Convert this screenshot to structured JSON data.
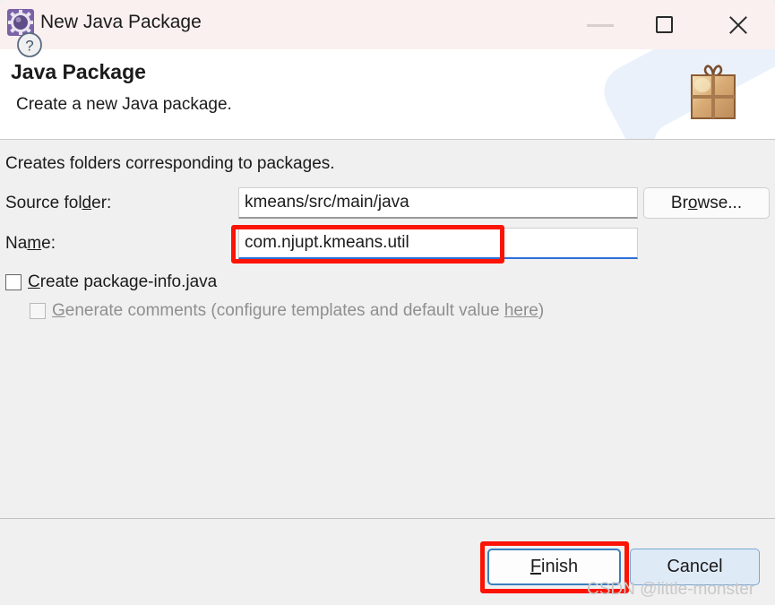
{
  "window": {
    "title": "New Java Package",
    "app_icon": "java-package-gear-icon",
    "controls": {
      "minimize": "Minimize",
      "maximize": "Maximize",
      "close": "Close"
    }
  },
  "header": {
    "title": "Java Package",
    "subtitle": "Create a new Java package.",
    "icon": "gift-box-icon"
  },
  "main": {
    "hint": "Creates folders corresponding to packages.",
    "source_folder": {
      "label_before": "Source fol",
      "label_mnemonic": "d",
      "label_after": "er:",
      "value": "kmeans/src/main/java",
      "placeholder": ""
    },
    "name": {
      "label_before": "Na",
      "label_mnemonic": "m",
      "label_after": "e:",
      "value": "com.njupt.kmeans.util",
      "placeholder": ""
    },
    "browse_button": {
      "label_before": "Br",
      "label_mnemonic": "o",
      "label_after": "wse..."
    },
    "create_package_info": {
      "mnemonic": "C",
      "label_after": "reate package-info.java",
      "checked": false,
      "enabled": true
    },
    "generate_comments": {
      "mnemonic": "G",
      "label_mid": "enerate comments (configure templates and default value ",
      "link": "here",
      "label_end": ")",
      "checked": false,
      "enabled": false
    }
  },
  "footer": {
    "help_icon": "help-question-icon",
    "finish_button": {
      "label_mnemonic": "F",
      "label_after": "inish"
    },
    "cancel_button": {
      "label": "Cancel"
    }
  },
  "annotations": {
    "highlight_color": "#fc1303",
    "watermark": "CSDN @little-monster"
  },
  "colors": {
    "titlebar": "#faf0ef",
    "header": "#ffffff",
    "body": "#f0f0f0",
    "focus_underline": "#2e6fd9",
    "default_button_border": "#3a7ebf",
    "cancel_button_fill": "#dfeaf7"
  }
}
